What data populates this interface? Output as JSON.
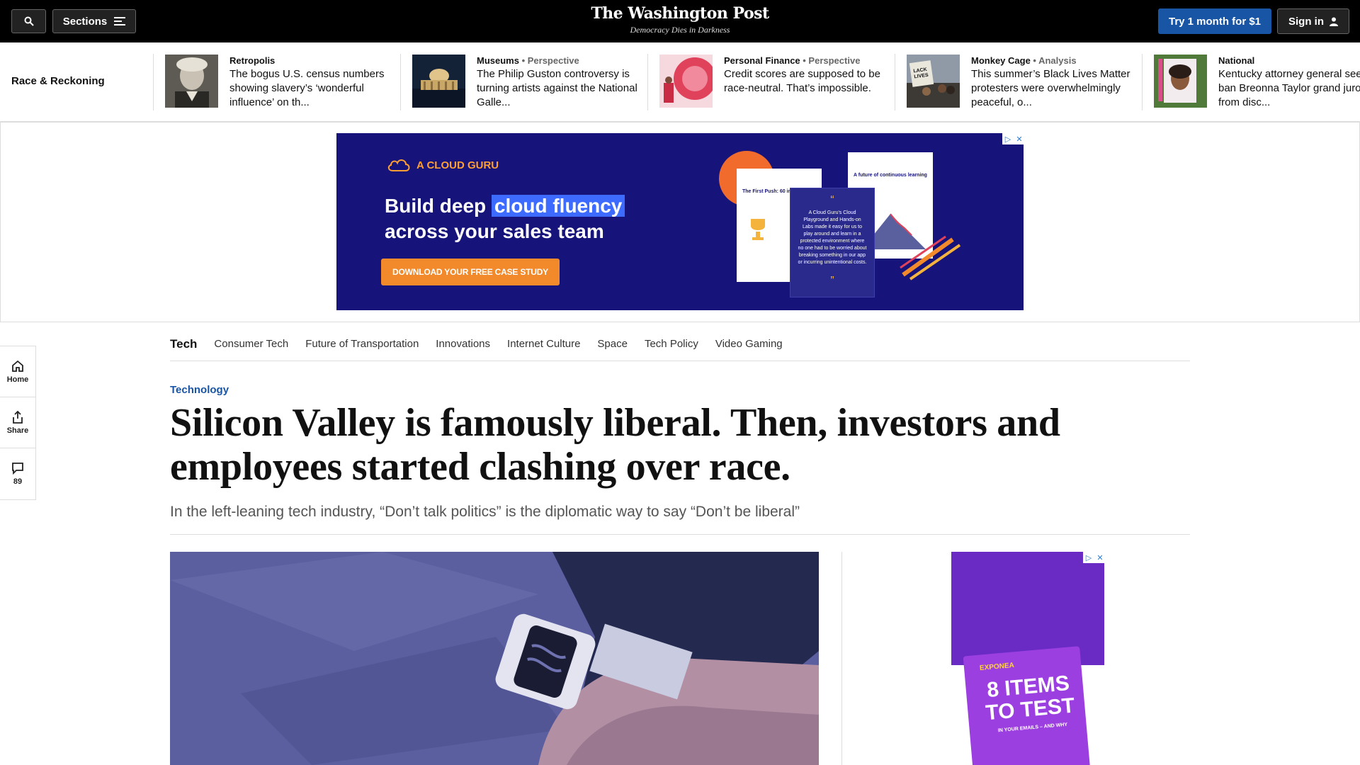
{
  "header": {
    "sections_label": "Sections",
    "logo": "The Washington Post",
    "tagline": "Democracy Dies in Darkness",
    "try_label": "Try 1 month for $1",
    "signin_label": "Sign in"
  },
  "race_strip": {
    "title": "Race & Reckoning",
    "items": [
      {
        "kicker": "Retropolis",
        "sub": "",
        "headline": "The bogus U.S. census numbers showing slavery’s ‘wonderful influence’ on th..."
      },
      {
        "kicker": "Museums",
        "sub": " • Perspective",
        "headline": "The Philip Guston controversy is turning artists against the National Galle..."
      },
      {
        "kicker": "Personal Finance",
        "sub": " • Perspective",
        "headline": "Credit scores are supposed to be race-neutral. That’s impossible."
      },
      {
        "kicker": "Monkey Cage",
        "sub": " • Analysis",
        "headline": "This summer’s Black Lives Matter protesters were overwhelmingly peaceful, o..."
      },
      {
        "kicker": "National",
        "sub": "",
        "headline": "Kentucky attorney general seeks to ban Breonna Taylor grand juror from disc..."
      }
    ]
  },
  "ad_banner": {
    "brand": "A CLOUD GURU",
    "headline_pre": "Build deep ",
    "headline_hl": "cloud fluency",
    "headline_post": "across your sales team",
    "cta": "DOWNLOAD YOUR FREE CASE STUDY",
    "card1_title": "The First Push: 60 in 60",
    "card2_title": "A future of continuous learning",
    "quote_open": "“",
    "quote_close": "”",
    "quote": "A Cloud Guru's Cloud Playground and Hands-on Labs made it easy for us to play around and learn in a protected environment where no one had to be worried about breaking something in our app or incurring unintentional costs."
  },
  "subnav": {
    "section": "Tech",
    "links": [
      "Consumer Tech",
      "Future of Transportation",
      "Innovations",
      "Internet Culture",
      "Space",
      "Tech Policy",
      "Video Gaming"
    ]
  },
  "rail": {
    "home": "Home",
    "share": "Share",
    "comments": "89"
  },
  "article": {
    "kicker": "Technology",
    "headline": "Silicon Valley is famously liberal. Then, investors and employees started clashing over race.",
    "dek": "In the left-leaning tech industry, “Don’t talk politics” is the diplomatic way to say “Don’t be liberal”"
  },
  "side_ad": {
    "brand": "EXPONEA",
    "title": "8 ITEMS TO TEST",
    "subtitle": "IN YOUR EMAILS – AND WHY"
  },
  "colors": {
    "accent_blue": "#1955a5",
    "ad_navy": "#16147a",
    "ad_orange": "#f28a2c",
    "ad_purple": "#6a2bc5"
  }
}
